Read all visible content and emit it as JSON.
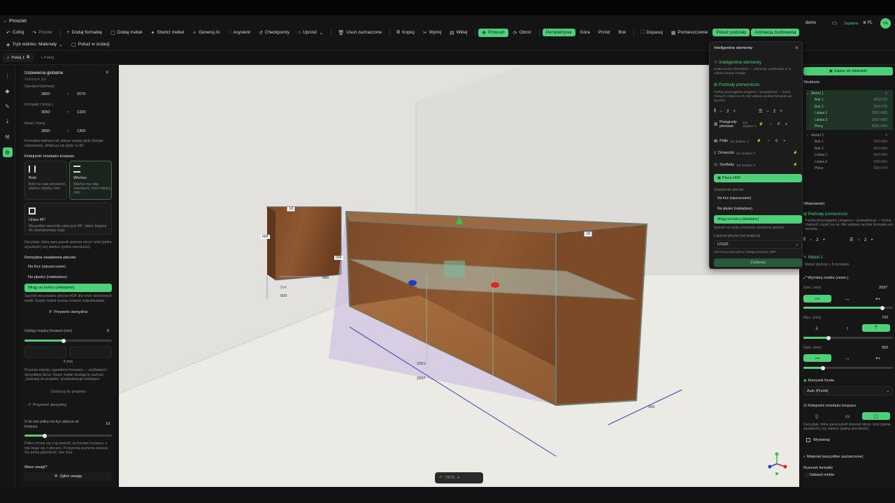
{
  "window": {
    "back_label": "← Prosciei"
  },
  "toolbar": {
    "undo": "Cofnij",
    "redo": "Ponów",
    "add_board": "Dodaj formatkę",
    "add_furniture": "Dodaj mebel",
    "create_furniture": "Stwórz mebel",
    "generate_ai": "Generuj AI",
    "assistant": "Asystent",
    "checkpoints": "Checkpointy",
    "simplify": "Uprość",
    "delete_selection": "Usuń zaznaczone",
    "copy": "Kopiuj",
    "cut": "Wytnij",
    "paste": "Wklej",
    "move": "Przesuń",
    "rotate": "Obróć",
    "perspective": "Perspektywa",
    "top": "Góra",
    "front": "Przód",
    "side": "Bok",
    "fit": "Dopasuj",
    "room": "Pomieszczenie",
    "show_divisions": "Pokaż podziały",
    "build_animation": "Animacja budowania",
    "user_label": "demo",
    "saved": "Zapisano",
    "lang": "PL",
    "avatar": "VK"
  },
  "toolbar2": {
    "view_mode": "Tryb widoku: Materiały",
    "isolation": "Pokaż w izolacji"
  },
  "tabs": [
    {
      "label": "Pokój 1"
    },
    {
      "label": "+ Pokój"
    }
  ],
  "left_panel": {
    "title": "Ustawienia globalne",
    "cut_section": "Naddatek płyt",
    "boards": [
      {
        "label": "Standard (laminat)",
        "w": "2800",
        "h": "2070"
      },
      {
        "label": "Kompakt ( komp.)",
        "w": "3050",
        "h": "1320"
      },
      {
        "label": "Metal / fronty",
        "w": "2800",
        "h": "1300"
      }
    ],
    "board_note": "Formatka większa niż arkusz swojej płyty dostaje ostrzeżenie „Większa niż płyta” w 3D.",
    "assembly_title": "Kolejność montażu korpusu",
    "assembly_options": [
      {
        "title": "Boki",
        "desc": "Boki na całą wysokość, wieńce między nimi"
      },
      {
        "title": "Wieńce",
        "desc": "Wieńce na całą szerokość, boki między nimi"
      },
      {
        "title": "Ucios 45°",
        "desc": "Wszystkie narożniki cięte pod 48°, dekor biegnie do zewnętrznego rogu."
      }
    ],
    "assembly_note": "Decyduje, która para paneli stanowi obrys: boki (pełna wysokość) czy wieńce (pełna szerokość).",
    "hdf_title": "Domyślne osadzenie pleców",
    "hdf_options": [
      "Na frez (wpuszczane)",
      "Na płasko (nakładane)",
      "Wrąg na końcu (wkładane)"
    ],
    "hdf_note": "Sposób mocowania pleców HDF dla nowo tworzonych mebli. Każdy mebel można zmienić indywidualnie.",
    "restore_default": "Przywróć domyślne",
    "gap_label": "Odstęp między frontami (mm)",
    "gap_value": "5",
    "gap_unit": "5 mm",
    "gap_note": "Przerwa między sąsiednimi frontami — szufladami i skrzydłami drzwi. Nowe meble dostają tę wartość; „Zastosuj do projektu” przebudowuje istniejące.",
    "apply_project": "Zastosuj do projektu",
    "restore_default2": "Przywróć domyślny",
    "shelf_label": "O ile mm półka ma być płytsza od korpusu",
    "shelf_value": "10",
    "shelf_note": "Półka chowa się o tę wartość za frontem korpusu, z tyłu licuje się z plecami. Przegroda pozioma zawsze ma pełną głębokość, bez luzu.",
    "feedback_q": "Masz uwagi?",
    "feedback_btn": "Zgłoś uwagę"
  },
  "viewport": {
    "dims": [
      "18",
      "684",
      "560",
      "600",
      "564",
      "2061",
      "2097",
      "560",
      "18",
      "684"
    ],
    "bottom_pill": "72/72"
  },
  "ai_panel": {
    "title": "Inteligentne elementy",
    "header": "Inteligentne elementy",
    "intro": "Ustaw liczbę elementów — „Zastosuj” przebuduje je w całości korpus zostaje.",
    "divisions_title": "Podziały pomocnicze",
    "divisions_desc": "Punkty przyciągania (magnes + prowadnice) — liczba równych części na oś. Nie wpływa na listę formatek ani wycenę.",
    "div_v": "2",
    "div_h": "2",
    "rows": [
      {
        "label": "Przegrody pionowe",
        "note": "Już dodano: 0",
        "value": "0"
      },
      {
        "label": "Półki",
        "note": "Już dodano: 0",
        "value": "0"
      },
      {
        "label": "Drzwiczki",
        "note": "Już dodano: 0"
      },
      {
        "label": "Szuflady",
        "note": "Już dodano: 0"
      }
    ],
    "hdf_btn": "Plecy HDF",
    "mount_label": "Osadzenie pleców",
    "mount_options": [
      "Na frez (wpuszczane)",
      "Na płasko (nakładane)",
      "Wrąg na końcu (wkładane)"
    ],
    "mount_note": "Wartość na meblu przesłania ustawienie globalne",
    "laminate_label": "Laminat pleców (od wnętrza)",
    "laminate_value": "U1100",
    "laminate_note": "Od strony bazy plecy zostają surowym HDF.",
    "apply": "Zastosuj"
  },
  "right_panel": {
    "save_library": "Zapisz do biblioteki",
    "structure_title": "Struktura",
    "tree": [
      {
        "label": "Mebel 1",
        "count": "5",
        "hl": true
      },
      {
        "label": "Bok 1",
        "dims": "560×720",
        "hl": true
      },
      {
        "label": "Bok 2",
        "dims": "560×720",
        "hl": true
      },
      {
        "label": "Listwa 1",
        "dims": "2097×560",
        "hl": true
      },
      {
        "label": "Listwa 2",
        "dims": "2097×560",
        "hl": true
      },
      {
        "label": "Plecy",
        "dims": "2081×704",
        "hl": true
      },
      {
        "label": "Mebel 2",
        "count": "5",
        "hl": false
      },
      {
        "label": "Bok 1",
        "dims": "560×684",
        "hl": false
      },
      {
        "label": "Bok 2",
        "dims": "560×684",
        "hl": false
      },
      {
        "label": "Listwa 1",
        "dims": "600×560",
        "hl": false
      },
      {
        "label": "Listwa 2",
        "dims": "600×560",
        "hl": false
      },
      {
        "label": "Plecy",
        "dims": "584×704",
        "hl": false
      }
    ],
    "props_title": "Właściwości",
    "divisions_title": "Podziały pomocnicze",
    "divisions_desc": "Punkty przyciągania (magnes + prowadnice) — liczba równych części na oś. Nie wpływa na listę formatek ani wycenę.",
    "div_v": "2",
    "div_h": "2",
    "furniture_name": "Mebel 1",
    "furniture_note": "Mebel złożony z 5 formatek.",
    "dims_title": "Wymiary mebla (zewn.)",
    "width_label": "Szer. (mm)",
    "width_value": "2097",
    "width_frac": 0.88,
    "height_label": "Wys. (mm)",
    "height_value": "720",
    "height_frac": 0.28,
    "depth_label": "Głęb. (mm)",
    "depth_value": "560",
    "depth_frac": 0.22,
    "front_dir_title": "Kierunek frontu",
    "front_dir_value": "Auto (Przód)",
    "assembly_title": "Kolejność montażu korpusu",
    "assembly_note": "Decyduje, która para paneli stanowi obrys: boki (pełna wysokość) czy wieńce (pełna szerokość).",
    "align_label": "Wyrównaj",
    "material_title": "Materiał (wszystkie zaznaczone)",
    "drawing_title": "Rysunek formatki",
    "outline_label": "Gabaryt mebla"
  }
}
